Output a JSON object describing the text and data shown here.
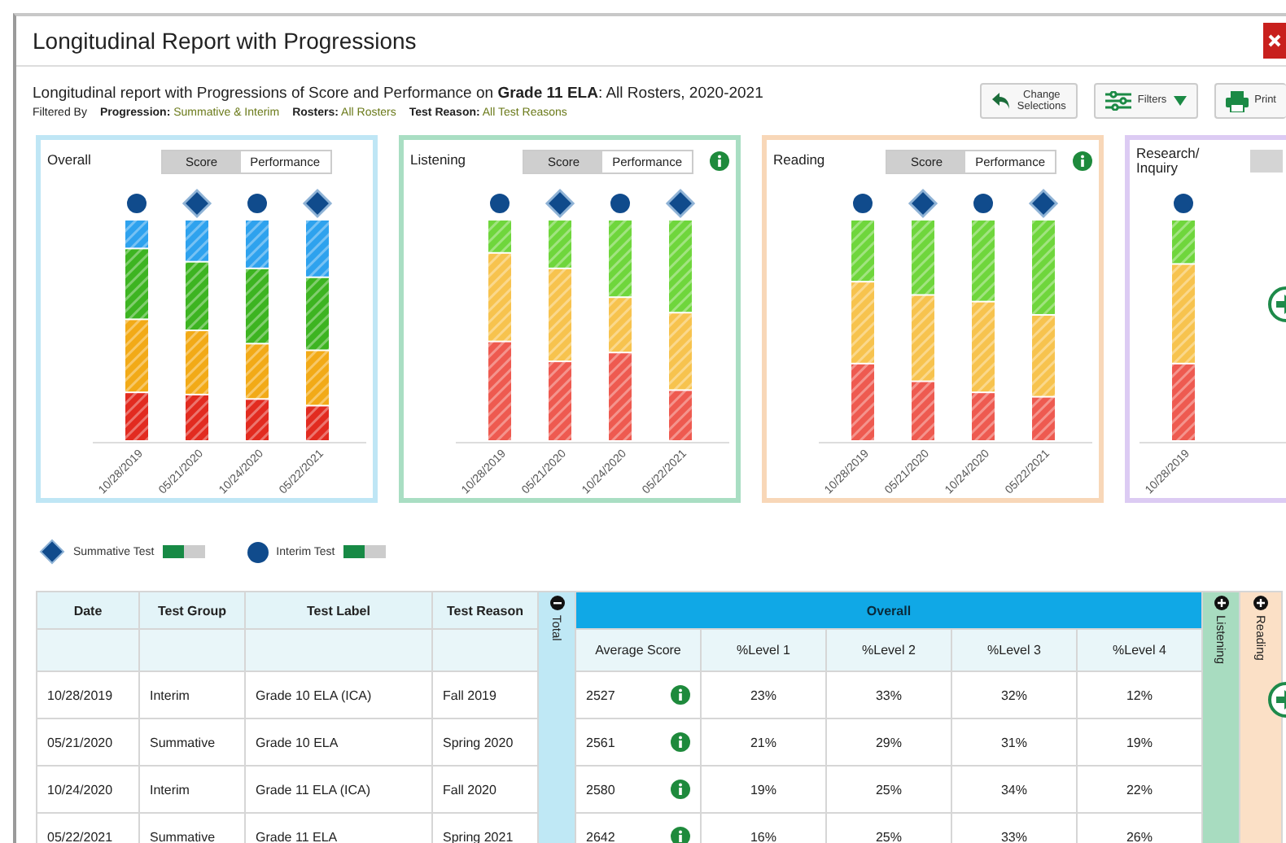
{
  "window": {
    "title": "Longitudinal Report with Progressions"
  },
  "header": {
    "description": "Longitudinal report with Progressions of Score and Performance on **Grade 11 ELA**: All Rosters, 2020-2021",
    "filtered_by": "Filtered By",
    "filters": [
      {
        "label": "Progression:",
        "value": "Summative & Interim"
      },
      {
        "label": "Rosters:",
        "value": "All Rosters"
      },
      {
        "label": "Test Reason:",
        "value": "All Test Reasons"
      }
    ],
    "buttons": [
      {
        "kind": "back",
        "label": "Change Selections"
      },
      {
        "kind": "filter",
        "label": "Filters"
      },
      {
        "kind": "print",
        "label": "Print"
      }
    ]
  },
  "panels": [
    {
      "title": "Overall",
      "toggle": [
        {
          "label": "Score",
          "selected": true
        },
        {
          "label": "Performance",
          "selected": false
        }
      ],
      "columns": [
        {
          "date": "10/28/2019",
          "kind": "interim"
        },
        {
          "date": "05/21/2020",
          "kind": "summative"
        },
        {
          "date": "10/24/2020",
          "kind": "interim"
        },
        {
          "date": "05/22/2021",
          "kind": "summative"
        }
      ]
    },
    {
      "title": "Listening",
      "toggle": [
        {
          "label": "Score",
          "selected": true
        },
        {
          "label": "Performance",
          "selected": false
        }
      ],
      "info": true,
      "columns": [
        {
          "date": "10/28/2019",
          "kind": "interim"
        },
        {
          "date": "05/21/2020",
          "kind": "summative"
        },
        {
          "date": "10/24/2020",
          "kind": "interim"
        },
        {
          "date": "05/22/2021",
          "kind": "summative"
        }
      ]
    },
    {
      "title": "Reading",
      "toggle": [
        {
          "label": "Score",
          "selected": true
        },
        {
          "label": "Performance",
          "selected": false
        }
      ],
      "info": true,
      "columns": [
        {
          "date": "10/28/2019",
          "kind": "interim"
        },
        {
          "date": "05/21/2020",
          "kind": "summative"
        },
        {
          "date": "10/24/2020",
          "kind": "interim"
        },
        {
          "date": "05/22/2021",
          "kind": "summative"
        }
      ]
    },
    {
      "title": "Research/ Inquiry",
      "columns": [
        {
          "date": "10/28/2019",
          "kind": "interim"
        }
      ]
    }
  ],
  "legend": [
    {
      "kind": "summative",
      "label": "Summative Test",
      "on": true
    },
    {
      "kind": "interim",
      "label": "Interim Test",
      "on": true
    }
  ],
  "table": {
    "columns": [
      "Date",
      "Test Group",
      "Test Label",
      "Test Reason"
    ],
    "total_label": "Total",
    "group_title": "Overall",
    "subcolumns": [
      "Average Score",
      "%Level 1",
      "%Level 2",
      "%Level 3",
      "%Level 4"
    ],
    "side_columns": [
      {
        "label": "Listening",
        "color": "#a8dcc0"
      },
      {
        "label": "Reading",
        "color": "#fbe0c6"
      }
    ],
    "rows": [
      {
        "cells": [
          "10/28/2019",
          "Interim",
          "Grade 10 ELA (ICA)",
          "Fall 2019"
        ],
        "average": "2527",
        "levels": [
          "23%",
          "33%",
          "32%",
          "12%"
        ]
      },
      {
        "cells": [
          "05/21/2020",
          "Summative",
          "Grade 10 ELA",
          "Spring 2020"
        ],
        "average": "2561",
        "levels": [
          "21%",
          "29%",
          "31%",
          "19%"
        ]
      },
      {
        "cells": [
          "10/24/2020",
          "Interim",
          "Grade 11 ELA (ICA)",
          "Fall 2020"
        ],
        "average": "2580",
        "levels": [
          "19%",
          "25%",
          "34%",
          "22%"
        ]
      },
      {
        "cells": [
          "05/22/2021",
          "Summative",
          "Grade 11 ELA",
          "Spring 2021"
        ],
        "average": "2642",
        "levels": [
          "16%",
          "25%",
          "33%",
          "26%"
        ]
      }
    ]
  }
}
